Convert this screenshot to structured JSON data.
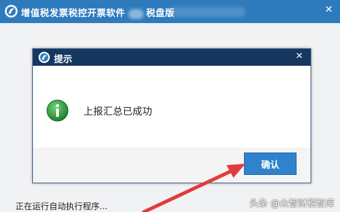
{
  "window": {
    "title_left": "增值税发票税控开票软件",
    "title_right": "税盘版",
    "close_glyph": "✕"
  },
  "dialog": {
    "title": "提示",
    "message": "上报汇总已成功",
    "ok_label": "确认",
    "close_glyph": "✕",
    "icon": "info-icon"
  },
  "status": {
    "text": "正在运行自动执行程序..."
  },
  "watermark": {
    "text": "头条 @众智财税智库"
  },
  "colors": {
    "title_bar": "#2d7bbd",
    "dialog_title": "#16375f",
    "button": "#2f83cc",
    "info_green": "#2e9b3a",
    "arrow": "#e23b3b"
  }
}
